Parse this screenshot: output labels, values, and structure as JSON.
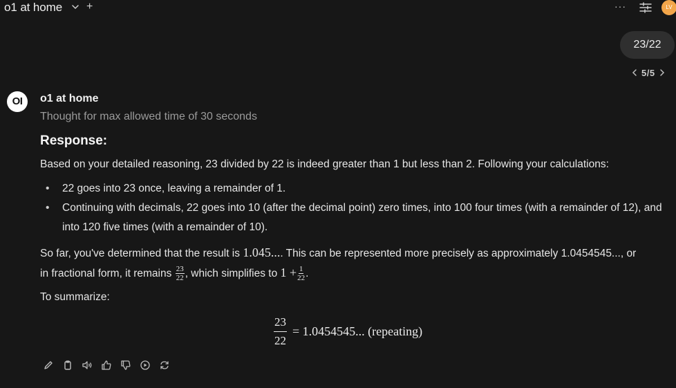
{
  "header": {
    "title": "o1 at home",
    "new_chat": "+",
    "more": "···",
    "avatar_initials": "LV"
  },
  "user_message": {
    "text": "23/22",
    "pager": {
      "current": "5/5"
    }
  },
  "assistant": {
    "logo_text": "OI",
    "name": "o1 at home",
    "thought_status": "Thought for max allowed time of 30 seconds",
    "response_heading": "Response:",
    "intro": "Based on your detailed reasoning, 23 divided by 22 is indeed greater than 1 but less than 2. Following your calculations:",
    "bullets": [
      "22 goes into 23 once, leaving a remainder of 1.",
      "Continuing with decimals, 22 goes into 10 (after the decimal point) zero times, into 100 four times (with a remainder of 12), and into 120 five times (with a remainder of 10)."
    ],
    "para2_a": "So far, you've determined that the result is ",
    "para2_math1": "1.045...",
    "para2_b": ". This can be represented more precisely as approximately 1.0454545..., or",
    "para3_a": "in fractional form, it remains ",
    "frac1_num": "23",
    "frac1_den": "22",
    "para3_b": ", which simplifies to ",
    "para3_math": "1 +",
    "frac2_num": "1",
    "frac2_den": "22",
    "para3_end": ".",
    "summary_label": "To summarize:",
    "display_num": "23",
    "display_den": "22",
    "display_rhs": "= 1.0454545... (repeating)"
  },
  "action_icons": [
    "edit-icon",
    "copy-icon",
    "read-aloud-icon",
    "thumbs-up-icon",
    "thumbs-down-icon",
    "continue-icon",
    "regenerate-icon"
  ],
  "colors": {
    "background": "#171717",
    "bubble": "#2f2f2f",
    "avatar": "#f3a64a",
    "muted_text": "#9b9b9b"
  }
}
